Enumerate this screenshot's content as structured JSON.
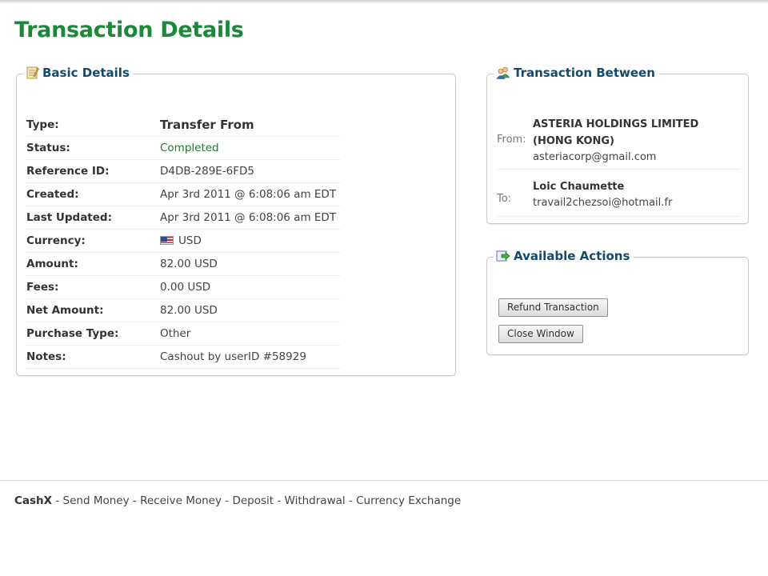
{
  "page": {
    "title": "Transaction Details"
  },
  "colors": {
    "title_green": "#1a8a3a",
    "legend_blue": "#134a6b",
    "status_green": "#1f7a2e"
  },
  "basic_details": {
    "legend": "Basic Details",
    "icon": "notepad-icon",
    "rows": [
      {
        "label": "Type:",
        "value": "Transfer From"
      },
      {
        "label": "Status:",
        "value": "Completed"
      },
      {
        "label": "Reference ID:",
        "value": "D4DB-289E-6FD5"
      },
      {
        "label": "Created:",
        "value": "Apr 3rd 2011 @ 6:08:06 am EDT"
      },
      {
        "label": "Last Updated:",
        "value": "Apr 3rd 2011 @ 6:08:06 am EDT"
      },
      {
        "label": "Currency:",
        "value": "USD",
        "icon": "us-flag-icon"
      },
      {
        "label": "Amount:",
        "value": "82.00 USD"
      },
      {
        "label": "Fees:",
        "value": "0.00 USD"
      },
      {
        "label": "Net Amount:",
        "value": "82.00 USD"
      },
      {
        "label": "Purchase Type:",
        "value": "Other"
      },
      {
        "label": "Notes:",
        "value": "Cashout by userID #58929"
      }
    ]
  },
  "transaction_between": {
    "legend": "Transaction Between",
    "icon": "users-icon",
    "from": {
      "label": "From:",
      "name": "ASTERIA HOLDINGS LIMITED (HONG KONG)",
      "email": "asteriacorp@gmail.com"
    },
    "to": {
      "label": "To:",
      "name": "Loic Chaumette",
      "email": "travail2chezsoi@hotmail.fr"
    }
  },
  "available_actions": {
    "legend": "Available Actions",
    "icon": "go-arrow-icon",
    "refund_label": "Refund Transaction",
    "close_label": "Close Window"
  },
  "footer": {
    "brand": "CashX",
    "links": [
      "Send Money",
      "Receive Money",
      "Deposit",
      "Withdrawal",
      "Currency Exchange"
    ]
  }
}
